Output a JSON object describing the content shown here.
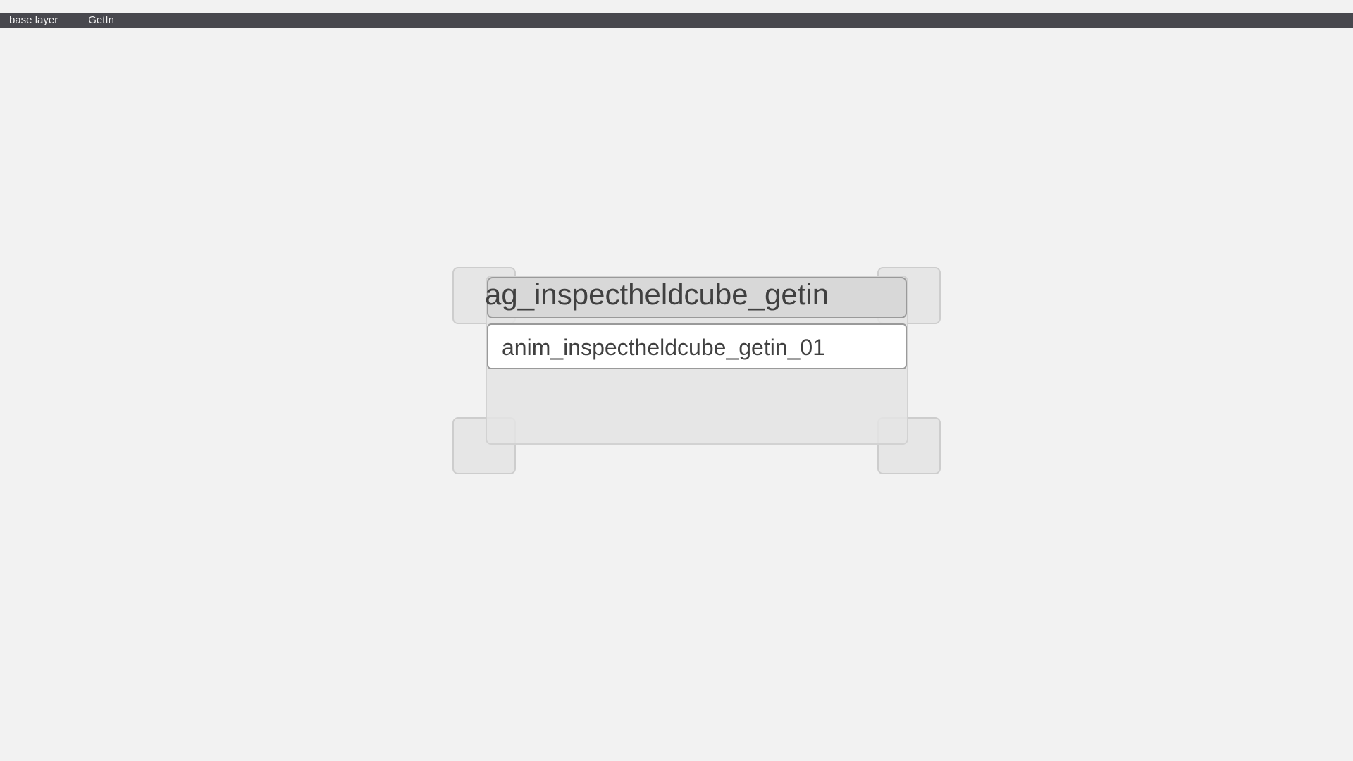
{
  "breadcrumb": {
    "items": [
      {
        "label": "base layer"
      },
      {
        "label": "GetIn"
      }
    ]
  },
  "graph": {
    "node": {
      "title": "ag_inspectheldcube_getin",
      "animation": "anim_inspectheldcube_getin_01"
    }
  },
  "colors": {
    "background": "#f2f2f2",
    "breadcrumb_bar": "#48484e",
    "node_body": "#e4e4e4",
    "node_header": "#d8d8d8",
    "anim_slot": "#ffffff",
    "text": "#404040"
  }
}
